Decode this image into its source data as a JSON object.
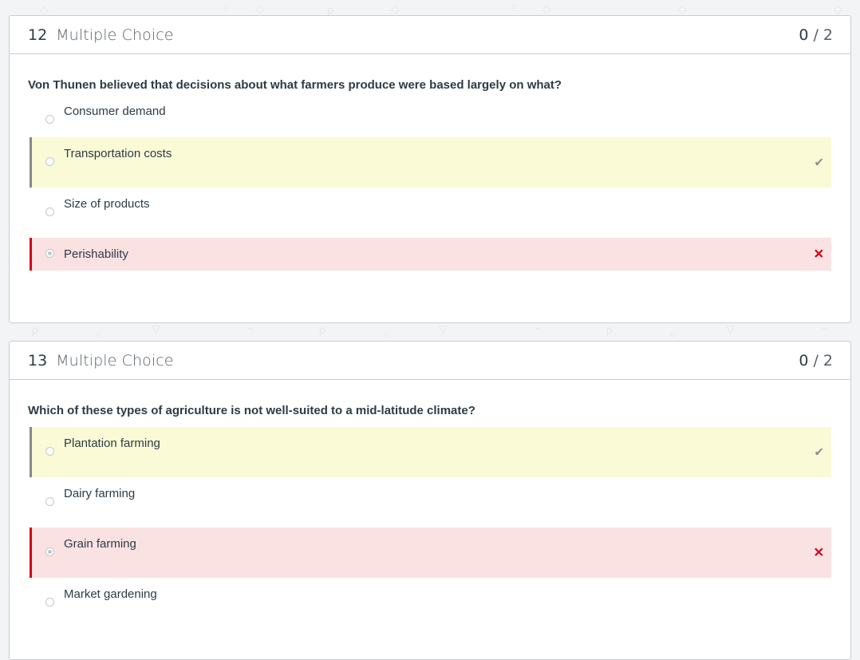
{
  "questions": [
    {
      "number": "12",
      "type": "Multiple Choice",
      "score_earned": "0",
      "score_sep": "/",
      "score_total": "2",
      "text": "Von Thunen believed that decisions about what farmers produce were based largely on what?",
      "answers": [
        {
          "label": "Consumer demand",
          "state": "none",
          "selected": false
        },
        {
          "label": "Transportation costs",
          "state": "correct",
          "selected": false
        },
        {
          "label": "Size of products",
          "state": "none",
          "selected": false
        },
        {
          "label": "Perishability",
          "state": "incorrect",
          "selected": true
        }
      ]
    },
    {
      "number": "13",
      "type": "Multiple Choice",
      "score_earned": "0",
      "score_sep": "/",
      "score_total": "2",
      "text": "Which of these types of agriculture is not well-suited to a mid-latitude climate?",
      "answers": [
        {
          "label": "Plantation farming",
          "state": "correct",
          "selected": false
        },
        {
          "label": "Dairy farming",
          "state": "none",
          "selected": false
        },
        {
          "label": "Grain farming",
          "state": "incorrect",
          "selected": true
        },
        {
          "label": "Market gardening",
          "state": "none",
          "selected": false
        }
      ]
    }
  ],
  "icons": {
    "correct": "checkmark-icon",
    "incorrect": "x-mark-icon"
  },
  "colors": {
    "correct_bg": "#fafbd6",
    "incorrect_bg": "#fae1e2",
    "incorrect_accent": "#d0021b"
  }
}
